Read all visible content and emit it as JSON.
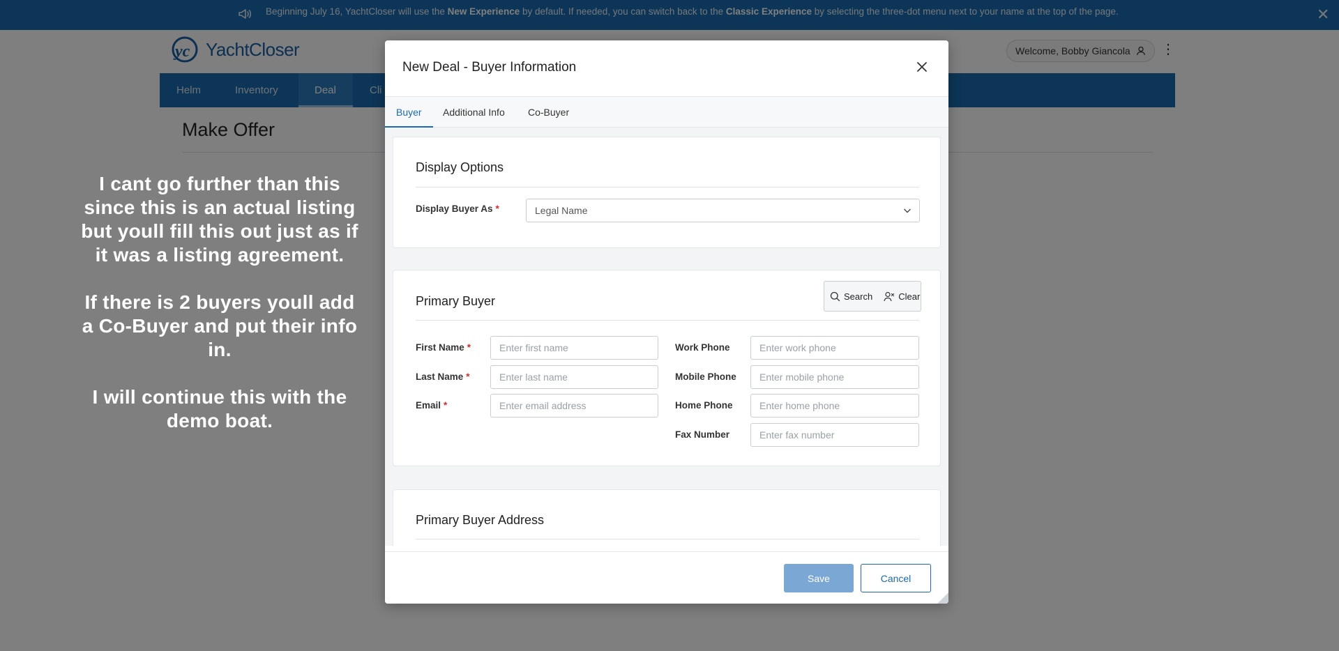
{
  "banner": {
    "icon": "megaphone-icon",
    "text_1": "Beginning July 16, YachtCloser will use the ",
    "bold_1": "New Experience",
    "text_2": " by default. If needed, you can switch back to the ",
    "bold_2": "Classic Experience",
    "text_3": " by selecting the three-dot menu next to your name at the top of the page.",
    "close_icon": "close-icon"
  },
  "app": {
    "logo_text": "YachtCloser",
    "welcome": "Welcome, Bobby Giancola",
    "nav": [
      {
        "label": "Helm"
      },
      {
        "label": "Inventory"
      },
      {
        "label": "Deal"
      },
      {
        "label": "Cli"
      }
    ],
    "active_nav": "Deal",
    "page_title": "Make Offer",
    "brand_color": "#1a6aae"
  },
  "caption": {
    "p1": "I cant go further than this since this is an actual listing but youll fill this out just as if it was a listing agreement.",
    "p2": "If there is 2 buyers youll add a Co-Buyer and put their info in.",
    "p3": "I will continue this with the demo boat."
  },
  "modal": {
    "title": "New Deal - Buyer Information",
    "tabs": [
      {
        "label": "Buyer"
      },
      {
        "label": "Additional Info"
      },
      {
        "label": "Co-Buyer"
      }
    ],
    "active_tab": "Buyer",
    "display_options": {
      "title": "Display Options",
      "display_as_label": "Display Buyer As",
      "display_as_value": "Legal Name"
    },
    "primary_buyer": {
      "title": "Primary Buyer",
      "search_label": "Search",
      "clear_label": "Clear",
      "first_name": {
        "label": "First Name",
        "placeholder": "Enter first name",
        "value": ""
      },
      "last_name": {
        "label": "Last Name",
        "placeholder": "Enter last name",
        "value": ""
      },
      "email": {
        "label": "Email",
        "placeholder": "Enter email address",
        "value": ""
      },
      "work_phone": {
        "label": "Work Phone",
        "placeholder": "Enter work phone",
        "value": ""
      },
      "mobile_phone": {
        "label": "Mobile Phone",
        "placeholder": "Enter mobile phone",
        "value": ""
      },
      "home_phone": {
        "label": "Home Phone",
        "placeholder": "Enter home phone",
        "value": ""
      },
      "fax_number": {
        "label": "Fax Number",
        "placeholder": "Enter fax number",
        "value": ""
      }
    },
    "address": {
      "title": "Primary Buyer Address"
    },
    "save_label": "Save",
    "cancel_label": "Cancel"
  }
}
